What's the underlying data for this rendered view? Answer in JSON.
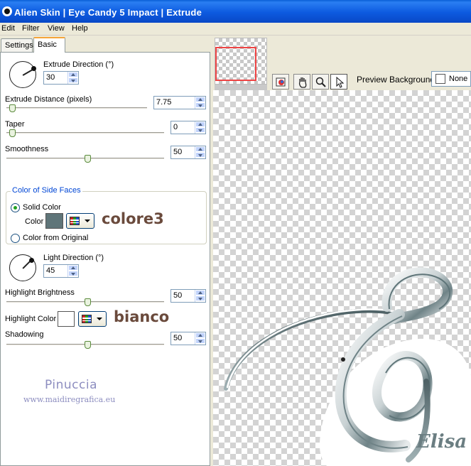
{
  "window": {
    "title": "Alien Skin | Eye Candy 5 Impact | Extrude",
    "titlebar_color": "#0a5fd6"
  },
  "menu": [
    "Edit",
    "Filter",
    "View",
    "Help"
  ],
  "tabs": [
    {
      "label": "Settings",
      "active": false
    },
    {
      "label": "Basic",
      "active": true
    }
  ],
  "controls": {
    "extrude_direction": {
      "label": "Extrude Direction (°)",
      "value": "30"
    },
    "extrude_distance": {
      "label": "Extrude Distance (pixels)",
      "value": "7.75",
      "slider_fraction": 0.0
    },
    "taper": {
      "label": "Taper",
      "value": "0",
      "slider_fraction": 0.0
    },
    "smoothness": {
      "label": "Smoothness",
      "value": "50",
      "slider_fraction": 0.5
    },
    "side_faces": {
      "title": "Color of Side Faces",
      "solid_color_label": "Solid Color",
      "solid_color_selected": true,
      "color_label": "Color",
      "color_value": "#5f7579",
      "from_original_label": "Color from Original",
      "annotation": "colore3"
    },
    "light_direction": {
      "label": "Light Direction (°)",
      "value": "45"
    },
    "highlight_brightness": {
      "label": "Highlight Brightness",
      "value": "50",
      "slider_fraction": 0.5
    },
    "highlight_color": {
      "label": "Highlight Color",
      "color_value": "#ffffff",
      "annotation": "bianco"
    },
    "shadowing": {
      "label": "Shadowing",
      "value": "50",
      "slider_fraction": 0.5
    }
  },
  "watermark": {
    "name": "Pinuccia",
    "url": "www.maidiregrafica.eu"
  },
  "preview": {
    "background_label": "Preview Background:",
    "background_value": "None",
    "tools": [
      "preview-icon",
      "hand-icon",
      "zoom-icon",
      "pointer-icon"
    ],
    "artwork_text": "Elisa"
  }
}
